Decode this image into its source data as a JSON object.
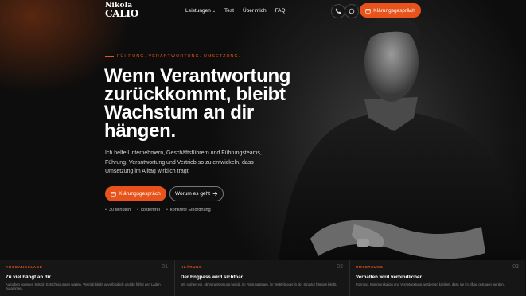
{
  "logo": {
    "line1": "Nikola",
    "line2": "CALIO"
  },
  "nav": {
    "items": [
      {
        "label": "Leistungen",
        "has_dropdown": true
      },
      {
        "label": "Test"
      },
      {
        "label": "Über mich"
      },
      {
        "label": "FAQ"
      }
    ]
  },
  "header": {
    "cta_label": "Klärungsgespräch"
  },
  "hero": {
    "eyebrow": "FÜHRUNG. VERANTWORTUNG. UMSETZUNG.",
    "headline": "Wenn Verantwortung zurückkommt, bleibt Wachstum an dir hängen.",
    "subtext": "Ich helfe Unternehmern, Geschäftsführern und Führungsteams, Führung, Verantwortung und Vertrieb so zu entwickeln, dass Umsetzung im Alltag wirklich trägt.",
    "primary_cta": "Klärungsgespräch",
    "secondary_cta": "Worum es geht",
    "bullets": [
      "30 Minuten",
      "kostenfrei",
      "konkrete Einordnung"
    ]
  },
  "cards": [
    {
      "tag": "AUSGANGSLAGE",
      "number": "01",
      "title": "Zu viel hängt an dir",
      "desc": "Aufgaben kommen zurück, Entscheidungen warten, Vertrieb bleibt unverbindlich und du fühlst den Laden zusammen."
    },
    {
      "tag": "KLÄRUNG",
      "number": "02",
      "title": "Der Engpass wird sichtbar",
      "desc": "Wir ordnen ein, ob Verantwortung bei dir, im Führungsteam, im Vertrieb oder in der Struktur hängen bleibt."
    },
    {
      "tag": "UMSETZUNG",
      "number": "03",
      "title": "Verhalten wird verbindlicher",
      "desc": "Führung, Kommunikation und Verantwortung werden so konkret, dass sie im Alltag getragen werden."
    }
  ],
  "colors": {
    "accent": "#e8531c",
    "background": "#0b0b0b",
    "card_bg": "#161616"
  },
  "icons": {
    "phone": "phone-icon",
    "whatsapp": "whatsapp-icon",
    "calendar": "calendar-icon",
    "arrow": "arrow-right-icon"
  }
}
